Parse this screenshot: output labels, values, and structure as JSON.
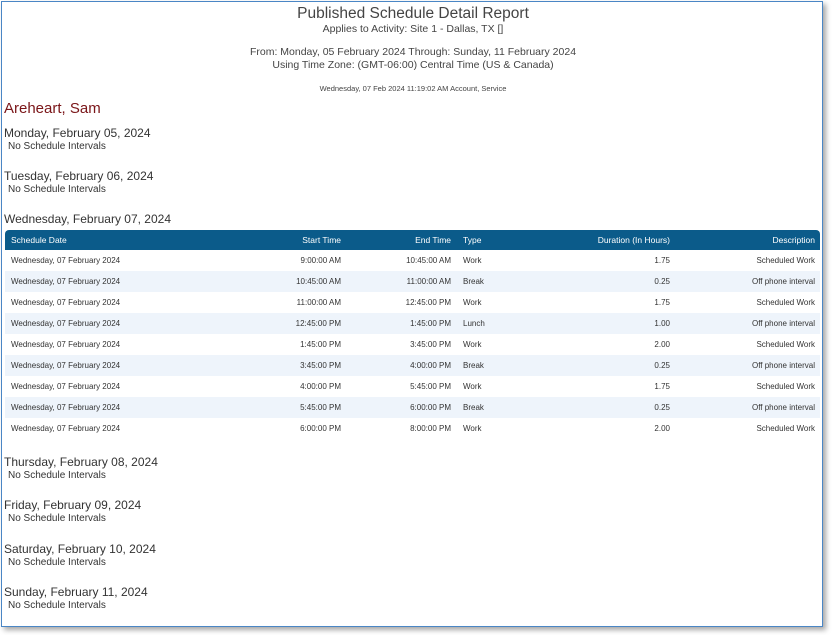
{
  "report": {
    "title": "Published Schedule Detail Report",
    "applies_to": "Applies to Activity: Site 1 - Dallas, TX []",
    "date_range": "From: Monday, 05 February 2024 Through: Sunday, 11 February 2024",
    "time_zone": "Using Time Zone: (GMT-06:00) Central Time (US & Canada)",
    "generated": "Wednesday, 07 Feb 2024 11:19:02 AM Account, Service"
  },
  "person": "Areheart, Sam",
  "no_schedule_text": "No Schedule Intervals",
  "days": [
    "Monday, February 05, 2024",
    "Tuesday, February 06, 2024",
    "Wednesday, February 07, 2024",
    "Thursday, February 08, 2024",
    "Friday, February 09, 2024",
    "Saturday, February 10, 2024",
    "Sunday, February 11, 2024"
  ],
  "table": {
    "headers": [
      "Schedule Date",
      "Start Time",
      "End Time",
      "Type",
      "Duration (In Hours)",
      "Description"
    ],
    "rows": [
      [
        "Wednesday, 07 February 2024",
        "9:00:00 AM",
        "10:45:00 AM",
        "Work",
        "1.75",
        "Scheduled Work"
      ],
      [
        "Wednesday, 07 February 2024",
        "10:45:00 AM",
        "11:00:00 AM",
        "Break",
        "0.25",
        "Off phone interval"
      ],
      [
        "Wednesday, 07 February 2024",
        "11:00:00 AM",
        "12:45:00 PM",
        "Work",
        "1.75",
        "Scheduled Work"
      ],
      [
        "Wednesday, 07 February 2024",
        "12:45:00 PM",
        "1:45:00 PM",
        "Lunch",
        "1.00",
        "Off phone interval"
      ],
      [
        "Wednesday, 07 February 2024",
        "1:45:00 PM",
        "3:45:00 PM",
        "Work",
        "2.00",
        "Scheduled Work"
      ],
      [
        "Wednesday, 07 February 2024",
        "3:45:00 PM",
        "4:00:00 PM",
        "Break",
        "0.25",
        "Off phone interval"
      ],
      [
        "Wednesday, 07 February 2024",
        "4:00:00 PM",
        "5:45:00 PM",
        "Work",
        "1.75",
        "Scheduled Work"
      ],
      [
        "Wednesday, 07 February 2024",
        "5:45:00 PM",
        "6:00:00 PM",
        "Break",
        "0.25",
        "Off phone interval"
      ],
      [
        "Wednesday, 07 February 2024",
        "6:00:00 PM",
        "8:00:00 PM",
        "Work",
        "2.00",
        "Scheduled Work"
      ]
    ]
  },
  "colors": {
    "header_bg": "#0b5b8a",
    "person_name": "#7a1518",
    "alt_row": "#eef4fb",
    "frame_border": "#4a86c5"
  }
}
